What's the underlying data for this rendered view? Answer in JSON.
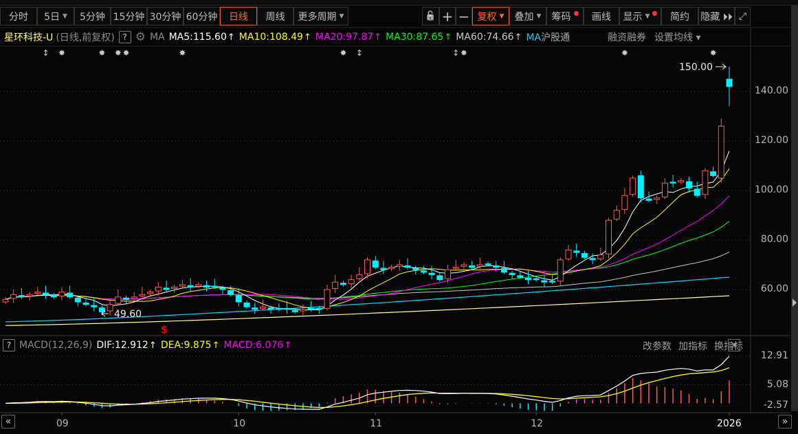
{
  "toolbar": {
    "periods": [
      {
        "label": "分时"
      },
      {
        "label": "5日",
        "caret": true
      },
      {
        "label": "5分钟"
      },
      {
        "label": "15分钟"
      },
      {
        "label": "30分钟"
      },
      {
        "label": "60分钟"
      },
      {
        "label": "日线",
        "active": true
      },
      {
        "label": "周线"
      },
      {
        "label": "更多周期",
        "caret": true
      }
    ],
    "tools": [
      {
        "label": "复权",
        "caret": true,
        "active": true
      },
      {
        "label": "叠加",
        "caret": true
      },
      {
        "label": "筹码",
        "dot": true
      },
      {
        "label": "画线"
      },
      {
        "label": "显示",
        "caret": true,
        "dot": true
      },
      {
        "label": "简约"
      },
      {
        "label": "隐藏 ⏵⏵"
      }
    ],
    "icons": {
      "lock": "unlock-icon",
      "plus": "zoom-in-icon",
      "minus": "zoom-out-icon",
      "expand": "fullscreen-icon"
    }
  },
  "legend": {
    "stock": "星环科技-U",
    "mode": "(日线,前复权)",
    "help": "?",
    "ma_label": "MA",
    "mas": [
      {
        "text": "MA5:115.60",
        "color": "#ffffff"
      },
      {
        "text": "MA10:108.49",
        "color": "#ffff00"
      },
      {
        "text": "MA20:97.87",
        "color": "#ff00ff"
      },
      {
        "text": "MA30:87.65",
        "color": "#00ff00"
      },
      {
        "text": "MA60:74.66",
        "color": "#c8c8c8"
      }
    ],
    "arrow": "↑",
    "extra_ma": "MA",
    "hgt": "沪股通",
    "links": [
      "融资融券",
      "设置均线 ▾"
    ]
  },
  "price_axis": {
    "ticks": [
      "140.00",
      "120.00",
      "100.00",
      "80.00",
      "60.00"
    ],
    "tick_values": [
      140,
      120,
      100,
      80,
      60
    ]
  },
  "annotations": {
    "high": "150.00",
    "low": "49.60",
    "dollar": "$"
  },
  "markers": [
    {
      "i": 5,
      "t": "↕"
    },
    {
      "i": 7,
      "t": "✸"
    },
    {
      "i": 12,
      "t": "✸"
    },
    {
      "i": 14,
      "t": "✸"
    },
    {
      "i": 15,
      "t": "✸"
    },
    {
      "i": 22,
      "t": "✸"
    },
    {
      "i": 42,
      "t": "✸"
    },
    {
      "i": 44,
      "t": "↕"
    },
    {
      "i": 56,
      "t": "↕"
    },
    {
      "i": 57,
      "t": "✸"
    },
    {
      "i": 77,
      "t": "✸"
    },
    {
      "i": 88,
      "t": "✸"
    }
  ],
  "colors": {
    "up": "#ff5a5a",
    "down": "#00f0ff",
    "ma5": "#ffffff",
    "ma10": "#ffff00",
    "ma20": "#ff00ff",
    "ma30": "#00ff00",
    "ma60": "#c8c8c8",
    "ma_long1": "#00d8ff",
    "ma_long2": "#ffff99"
  },
  "chart_data": {
    "type": "candlestick",
    "ylim": [
      47,
      152
    ],
    "closes": [
      56,
      58,
      57,
      58,
      59,
      58,
      57,
      59,
      57,
      55,
      54,
      53,
      51,
      54,
      57,
      56,
      57,
      58,
      59,
      61,
      60,
      61,
      62,
      61,
      62,
      61,
      61,
      60,
      58,
      55,
      53,
      52,
      53,
      52,
      52,
      52,
      51,
      52,
      52,
      52,
      60,
      63,
      62,
      64,
      66,
      72,
      69,
      68,
      69,
      70,
      69,
      68,
      67,
      66,
      64,
      68,
      69,
      70,
      69,
      70,
      70,
      69,
      67,
      66,
      65,
      64,
      64,
      63,
      63,
      72,
      76,
      75,
      73,
      72,
      74,
      88,
      92,
      98,
      105,
      97,
      96,
      97,
      103,
      103,
      104,
      101,
      98,
      108,
      106,
      126,
      142
    ],
    "overrides": {
      "12": {
        "l": 49.6
      },
      "79": {
        "o": 106
      },
      "89": {
        "o": 105
      },
      "90": {
        "o": 145,
        "h": 150,
        "l": 134
      }
    },
    "long_ma1": [
      47,
      65
    ],
    "long_ma2": [
      45.5,
      57.5
    ],
    "months": [
      {
        "i": 7,
        "label": "09"
      },
      {
        "i": 29,
        "label": "10"
      },
      {
        "i": 46,
        "label": "11"
      },
      {
        "i": 66,
        "label": "12"
      },
      {
        "i": 90,
        "label": "2026"
      }
    ]
  },
  "macd": {
    "title": "MACD(12,26,9)",
    "dif": "DIF:12.912",
    "dea": "DEA:9.875",
    "macd": "MACD:6.076",
    "arrow": "↑",
    "help": "?",
    "links": [
      "改参数",
      "加指标",
      "换指标"
    ],
    "close": "✕",
    "ticks": [
      "12.91",
      "5.08",
      "-2.57"
    ],
    "last_dif": 12.912
  },
  "nav": {
    "left": "«",
    "right": "»"
  }
}
